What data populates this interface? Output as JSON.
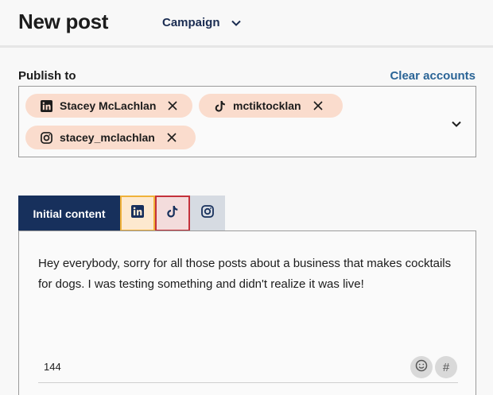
{
  "header": {
    "title": "New post",
    "campaign_label": "Campaign"
  },
  "publish": {
    "label": "Publish to",
    "clear_label": "Clear accounts",
    "accounts": [
      {
        "network": "linkedin",
        "name": "Stacey McLachlan"
      },
      {
        "network": "tiktok",
        "name": "mctiktocklan"
      },
      {
        "network": "instagram",
        "name": "stacey_mclachlan"
      }
    ]
  },
  "tabs": {
    "initial_label": "Initial content",
    "network_tabs": [
      "linkedin-icon",
      "tiktok-icon",
      "instagram-icon"
    ]
  },
  "editor": {
    "text": "Hey everybody, sorry for all those posts about a business that makes cocktails for dogs. I was testing something and didn't realize it was live!",
    "char_count": "144",
    "hashtag_label": "#"
  },
  "colors": {
    "chip_bg": "#fadccd",
    "active_tab": "#17305c",
    "link": "#2a6496",
    "linkedin_tab_border": "#f0b23a",
    "tiktok_tab_border": "#c4323b"
  }
}
